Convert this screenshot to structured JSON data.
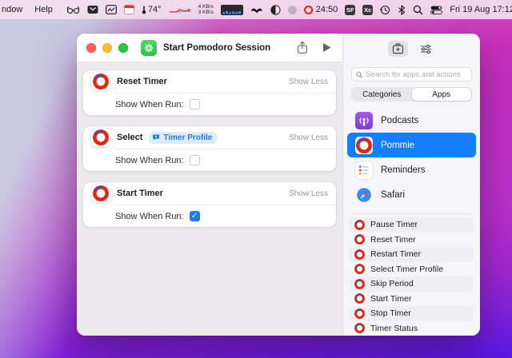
{
  "menu_bar": {
    "menus": [
      "ndow",
      "Help"
    ],
    "weather_temp": "74°",
    "network": {
      "up": "4 KB/s",
      "down": "3 KB/s"
    },
    "pommie_timer": "24:50",
    "badges": [
      "SF",
      "Xc"
    ],
    "clock": "Fri 19 Aug 17:12"
  },
  "titlebar": {
    "title": "Start Pomodoro Session"
  },
  "canvas": {
    "cards": [
      {
        "title": "Reset Timer",
        "collapse": "Show Less",
        "param": "Show When Run:",
        "checked": false
      },
      {
        "title": "Select",
        "token": "Timer Profile",
        "collapse": "Show Less",
        "param": "Show When Run:",
        "checked": false
      },
      {
        "title": "Start Timer",
        "collapse": "Show Less",
        "param": "Show When Run:",
        "checked": true
      }
    ]
  },
  "sidebar": {
    "search_placeholder": "Search for apps and actions",
    "segments": [
      "Categories",
      "Apps"
    ],
    "selected_segment": "Apps",
    "apps": [
      {
        "name": "Podcasts",
        "selected": false
      },
      {
        "name": "Pommie",
        "selected": true
      },
      {
        "name": "Reminders",
        "selected": false
      },
      {
        "name": "Safari",
        "selected": false
      }
    ],
    "actions": [
      "Pause Timer",
      "Reset Timer",
      "Restart Timer",
      "Select Timer Profile",
      "Skip Period",
      "Start Timer",
      "Stop Timer",
      "Timer Status"
    ]
  },
  "icons": {
    "menu": [
      "glasses-icon",
      "inbox-icon",
      "stats-icon",
      "calendar-icon",
      "thermometer-icon",
      "sparkline-icon",
      "cpu-meter-icon",
      "bartender-icon",
      "contrast-icon",
      "gray-dot-icon",
      "pommie-ring-icon",
      "time-machine-icon",
      "bluetooth-icon",
      "spotlight-icon",
      "control-center-icon"
    ],
    "titlebar": [
      "shortcuts-app-icon",
      "share-icon",
      "play-icon"
    ],
    "sidebar": [
      "action-library-icon",
      "sliders-icon",
      "search-icon",
      "podcasts-app-icon",
      "pommie-app-icon",
      "reminders-app-icon",
      "safari-app-icon"
    ]
  },
  "colors": {
    "accent_blue": "#157efb",
    "pommie_red": "#e8230f",
    "pommie_dark_arc": "#8e3b5e",
    "shortcut_green": "#3fcf5b",
    "wallpaper_magenta": "#cb2fb6",
    "wallpaper_violet": "#5a17e6",
    "menubar_pink": "#f4dff0"
  }
}
